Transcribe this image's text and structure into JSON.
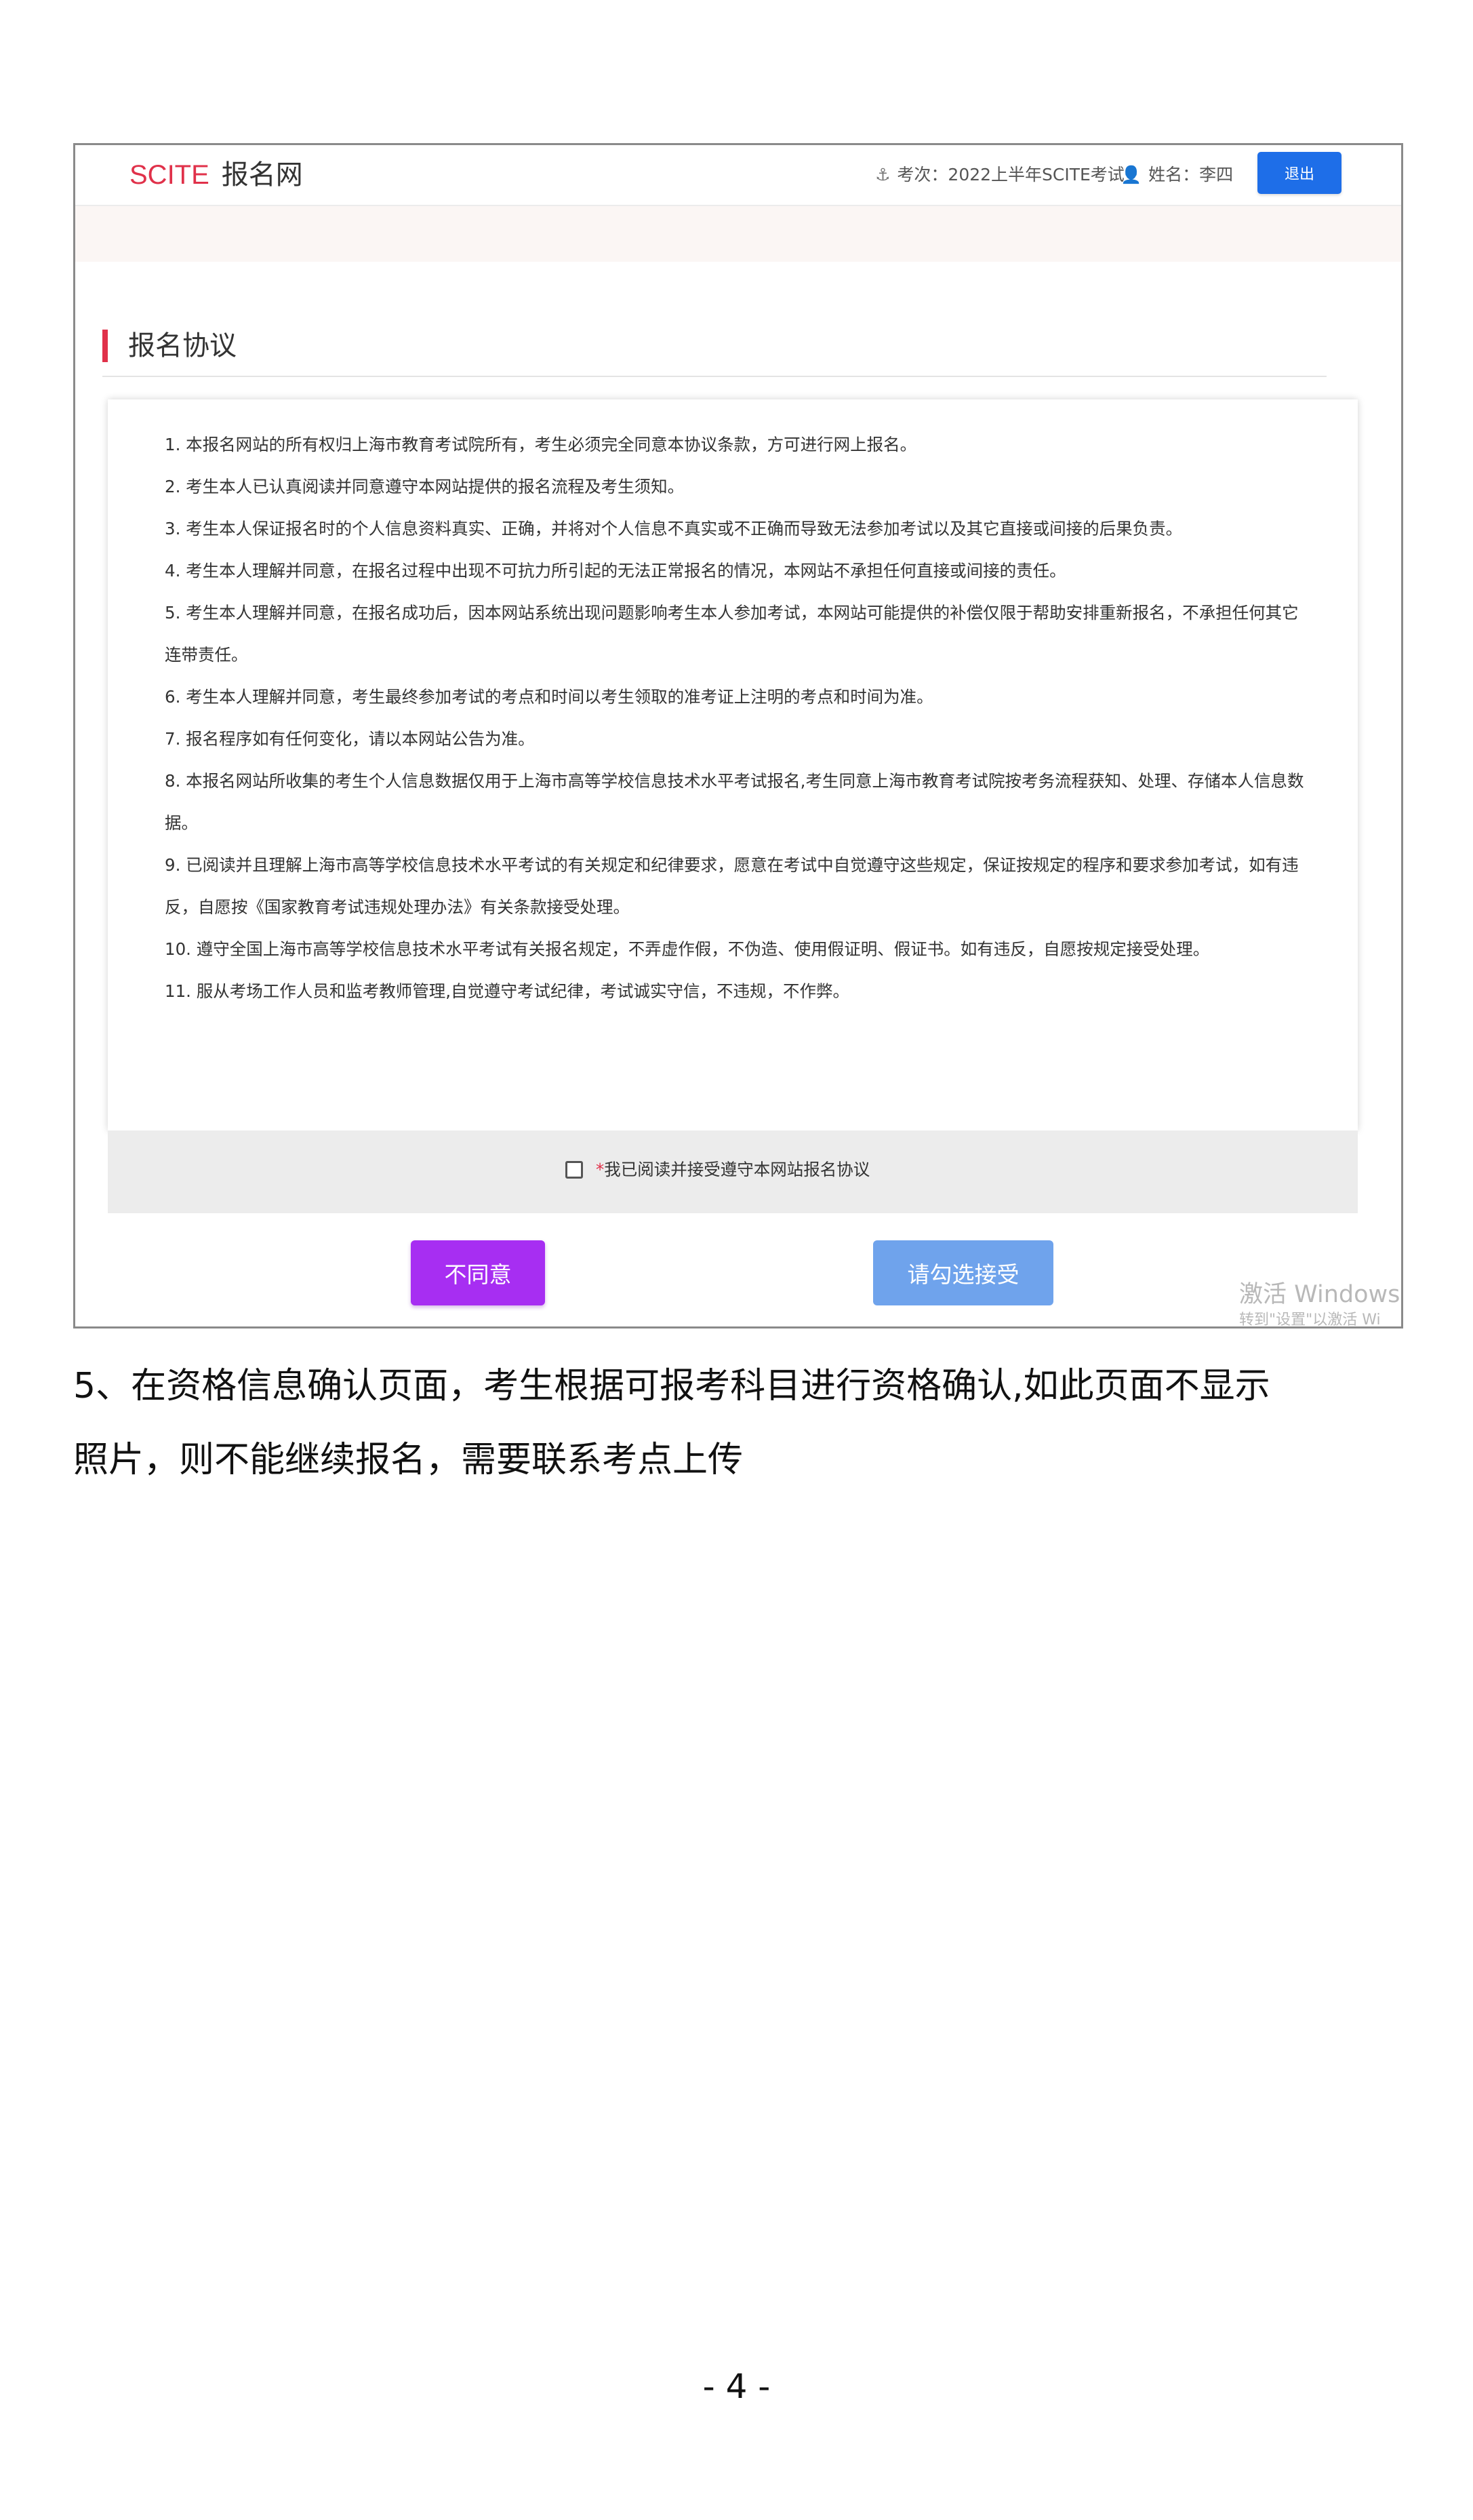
{
  "header": {
    "brand_scite": "SCITE",
    "brand_site": "报名网",
    "exam_icon": "anchor-icon",
    "exam_text": "考次：2022上半年SCITE考试",
    "user_icon": "user-icon",
    "user_text": "姓名：李四",
    "logout_label": "退出"
  },
  "section_title": "报名协议",
  "terms": [
    "1. 本报名网站的所有权归上海市教育考试院所有，考生必须完全同意本协议条款，方可进行网上报名。",
    "2. 考生本人已认真阅读并同意遵守本网站提供的报名流程及考生须知。",
    "3. 考生本人保证报名时的个人信息资料真实、正确，并将对个人信息不真实或不正确而导致无法参加考试以及其它直接或间接的后果负责。",
    "4. 考生本人理解并同意，在报名过程中出现不可抗力所引起的无法正常报名的情况，本网站不承担任何直接或间接的责任。",
    "5. 考生本人理解并同意，在报名成功后，因本网站系统出现问题影响考生本人参加考试，本网站可能提供的补偿仅限于帮助安排重新报名，不承担任何其它连带责任。",
    "6. 考生本人理解并同意，考生最终参加考试的考点和时间以考生领取的准考证上注明的考点和时间为准。",
    "7. 报名程序如有任何变化，请以本网站公告为准。",
    "8. 本报名网站所收集的考生个人信息数据仅用于上海市高等学校信息技术水平考试报名,考生同意上海市教育考试院按考务流程获知、处理、存储本人信息数据。",
    "9. 已阅读并且理解上海市高等学校信息技术水平考试的有关规定和纪律要求，愿意在考试中自觉遵守这些规定，保证按规定的程序和要求参加考试，如有违反，自愿按《国家教育考试违规处理办法》有关条款接受处理。",
    "10. 遵守全国上海市高等学校信息技术水平考试有关报名规定，不弄虚作假，不伪造、使用假证明、假证书。如有违反，自愿按规定接受处理。",
    "11. 服从考场工作人员和监考教师管理,自觉遵守考试纪律，考试诚实守信，不违规，不作弊。"
  ],
  "agree": {
    "required_mark": "*",
    "label": "我已阅读并接受遵守本网站报名协议",
    "checked": false
  },
  "buttons": {
    "disagree": "不同意",
    "accept": "请勾选接受"
  },
  "watermark": {
    "line1": "激活 Windows",
    "line2": "转到\"设置\"以激活 Wi"
  },
  "doc_paragraph": {
    "line1": "5、在资格信息确认页面，考生根据可报考科目进行资格确认,如此页面不显示",
    "line2": "照片，则不能继续报名，需要联系考点上传"
  },
  "page_number": "- 4 -",
  "colors": {
    "brand_red": "#e0314a",
    "logout_blue": "#1e6ee8",
    "disagree_purple": "#a72ef2",
    "accept_blue": "#6fa3ec"
  }
}
